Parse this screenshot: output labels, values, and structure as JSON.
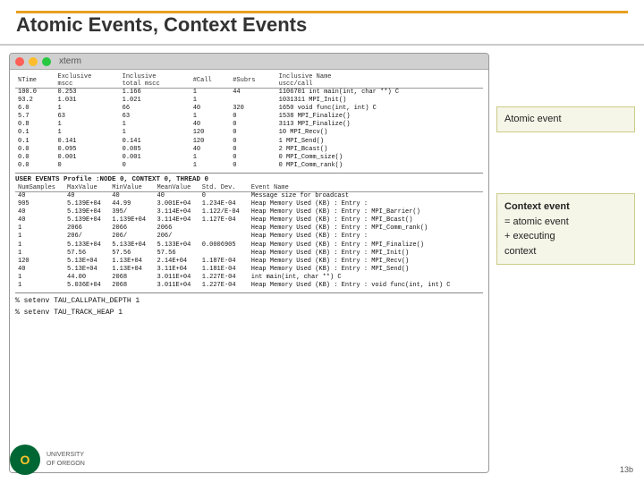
{
  "header": {
    "title": "Atomic Events, Context Events"
  },
  "terminal": {
    "titlebar": "xterm",
    "traffic_lights": [
      "red",
      "yellow",
      "green"
    ],
    "table1": {
      "columns": [
        "%Time",
        "Exclusive mscc",
        "Inclusive total mscc",
        "#Call",
        "#Subrs",
        "Inclusive Name uscc/call"
      ],
      "rows": [
        [
          "100.0",
          "0.253",
          "1.166",
          "1",
          "44",
          "1106701 int main(int, char **) C"
        ],
        [
          "93.2",
          "1.031",
          "1.021",
          "1",
          "",
          "1031311 MPI_Init()"
        ],
        [
          "6.0",
          "1",
          "66",
          "40",
          "320",
          "1650 void func(int, int) C"
        ],
        [
          "5.7",
          "63",
          "63",
          "1",
          "0",
          "1538 MPI_Finalize()"
        ],
        [
          "0.8",
          "1",
          "1",
          "40",
          "0",
          "3113 MPI_Finalize()"
        ],
        [
          "0.1",
          "1",
          "1",
          "120",
          "0",
          "10 MPI_Recv()"
        ],
        [
          "0.1",
          "0.141",
          "0.141",
          "120",
          "0",
          "1 MPI_Send()"
        ],
        [
          "0.0",
          "0.095",
          "0.085",
          "40",
          "0",
          "2 MPI_Bcast()"
        ],
        [
          "0.0",
          "0.001",
          "0.001",
          "1",
          "0",
          "0 MPI_Comm_size()"
        ],
        [
          "0.0",
          "0",
          "0",
          "1",
          "0",
          "0 MPI_Comm_rank()"
        ]
      ]
    },
    "section2_header": "USER EVENTS Profile :NODE 0, CONTEXT 0, THREAD 0",
    "table2": {
      "columns": [
        "NumSamples",
        "MaxValue",
        "MinValue",
        "MeanValue",
        "Std. Dev.",
        "Event Name"
      ],
      "rows": [
        [
          "40",
          "40",
          "40",
          "40",
          "0",
          "Message size for broadcast"
        ],
        [
          "905",
          "5.139E+04",
          "44.99",
          "3.001E+04",
          "1.234E-04",
          "Heap Memory Used (KB) : Entry : "
        ],
        [
          "40",
          "5.139E+04",
          "395/",
          "3.114E+04",
          "1.122/E-04",
          "Heap Memory Used (KB) : Entry : MPI_Barrier()"
        ],
        [
          "40",
          "5.139E+04",
          "1.139E+04",
          "3.114E+04",
          "1.127E-04",
          "Heap Memory Used (KB) : Entry : MPI_Bcast()"
        ],
        [
          "1",
          "2066",
          "2066",
          "2066",
          "",
          "Heap Memory Used (KB) : Entry : MPI_Comm_rank()"
        ],
        [
          "1",
          "206/",
          "206/",
          "206/",
          "",
          "Heap Memory Used (KB) : Entry :"
        ],
        [
          "1",
          "5.133E+04",
          "5.133E+04",
          "5.133E+04",
          "0.0006905",
          "Heap Memory Used (KB) : Entry : MPI_Finalize()"
        ],
        [
          "1",
          "57.56",
          "57.56",
          "57.56",
          "",
          "Heap Memory Used (KB) : Entry : MPI_Init()"
        ],
        [
          "120",
          "5.13E+04",
          "1.13E+04",
          "2.14E+04",
          "1.187E-04",
          "Heap Memory Used (KB) : Entry : MPI_Recv()"
        ],
        [
          "40",
          "5.13E+04",
          "1.13E+04",
          "3.11E+04",
          "1.181E-04",
          "Heap Memory Used (KB) : Entry : MPI_Send()"
        ],
        [
          "1",
          "44.00",
          "2068",
          "3.011E+04",
          "1.227E-04",
          "int main(int, char **) C"
        ],
        [
          "1",
          "5.036E+04",
          "2068",
          "3.011E+04",
          "1.227E-04",
          "Heap Memory Used (KB) : Entry : void func(int, int) C"
        ]
      ]
    },
    "commands": [
      "% setenv TAU_CALLPATH_DEPTH    1",
      "% setenv TAU_TRACK_HEAP  1"
    ]
  },
  "callouts": {
    "atomic": {
      "label": "Atomic event"
    },
    "context": {
      "lines": [
        "Context event",
        "= atomic event",
        "+ executing",
        "context"
      ]
    }
  },
  "footer": {
    "logo_text": "UNIVERSITY\nOF OREGON",
    "page_number": "13b"
  }
}
